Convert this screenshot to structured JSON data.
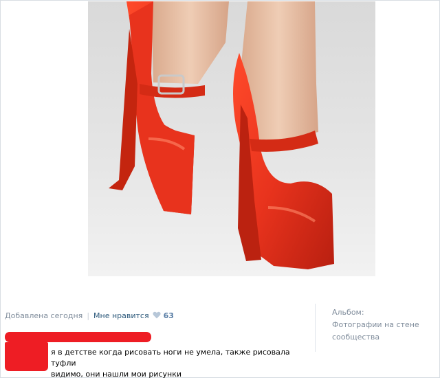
{
  "post": {
    "added_text": "Добавлена сегодня",
    "like_label": "Мне нравится",
    "like_count": "63"
  },
  "album": {
    "label": "Альбом:",
    "name_line1": "Фотографии на стене",
    "name_line2": "сообщества"
  },
  "comment": {
    "line1": "я в детстве когда рисовать ноги не умела, также рисовала",
    "line2": "туфли",
    "line3": "видимо, они нашли мои рисунки"
  },
  "icons": {
    "like": "heart-icon"
  },
  "colors": {
    "redaction": "#ee1d24",
    "shoe": "#e8331d",
    "link": "#2b587a"
  }
}
